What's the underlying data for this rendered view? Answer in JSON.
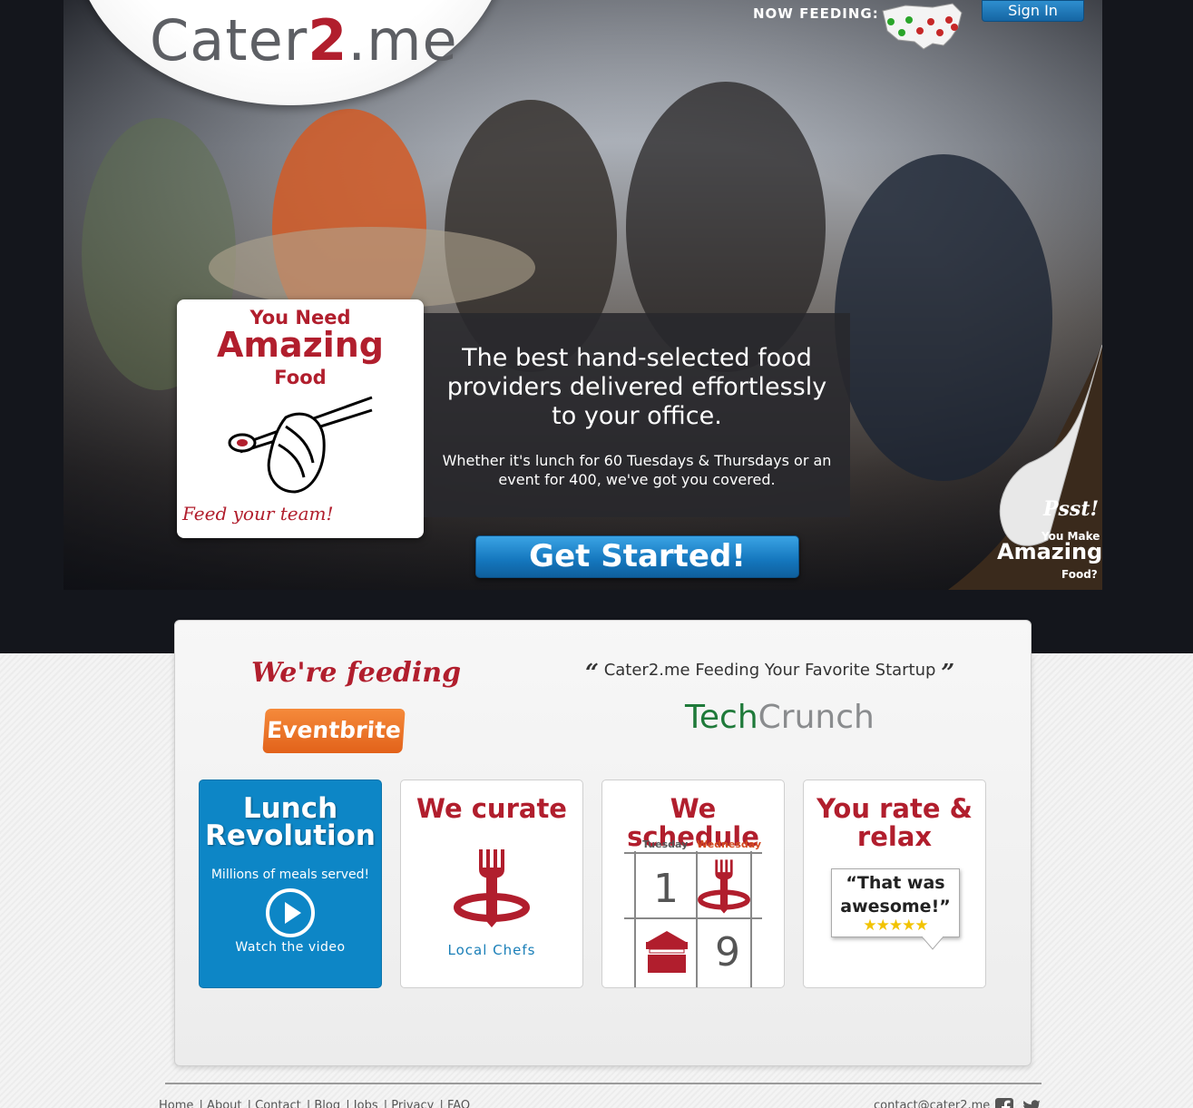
{
  "header": {
    "logo_left": "Cater",
    "logo_two": "2",
    "logo_right": ".me",
    "now_feeding": "NOW FEEDING:",
    "sign_in": "Sign In"
  },
  "hero": {
    "card_line1": "You Need",
    "card_line2": "Amazing",
    "card_line3": "Food",
    "card_script": "Feed your team!",
    "headline": "The best hand-selected food providers delivered effortlessly to your office.",
    "subline": "Whether it's lunch for 60 Tuesdays & Thursdays or an event for 400, we've got you covered.",
    "cta": "Get Started!",
    "curl_pst": "Psst!",
    "curl_you_make": "You Make",
    "curl_amazing": "Amazing",
    "curl_food": "Food?"
  },
  "panel": {
    "were_feeding": "We're feeding",
    "eventbrite": "Eventbrite",
    "quote_text": "Cater2.me Feeding Your Favorite Startup",
    "techcrunch_tech": "Tech",
    "techcrunch_crunch": "Crunch",
    "cards": {
      "lunch_title_1": "Lunch",
      "lunch_title_2": "Revolution",
      "lunch_sub": "Millions of meals served!",
      "lunch_watch": "Watch the video",
      "curate_title": "We curate",
      "curate_sub": "Local Chefs",
      "schedule_title": "We schedule",
      "schedule_day1": "Tuesday",
      "schedule_day2": "Wednesday",
      "schedule_num1": "1",
      "schedule_num2": "9",
      "rate_title": "You rate & relax",
      "rate_quote": "“That was awesome!”",
      "rate_stars": "★★★★★"
    }
  },
  "footer": {
    "links": [
      "Home",
      "About",
      "Contact",
      "Blog",
      "Jobs",
      "Privacy",
      "FAQ"
    ],
    "contact": "contact@cater2.me"
  },
  "colors": {
    "brand_red": "#b11e2d",
    "brand_blue": "#0d86c6",
    "hero_bg": "#14161c"
  },
  "icons": [
    "us-map-icon",
    "chopsticks-sushi-icon",
    "play-icon",
    "fork-pin-icon",
    "food-stall-icon",
    "facebook-icon",
    "twitter-icon"
  ]
}
